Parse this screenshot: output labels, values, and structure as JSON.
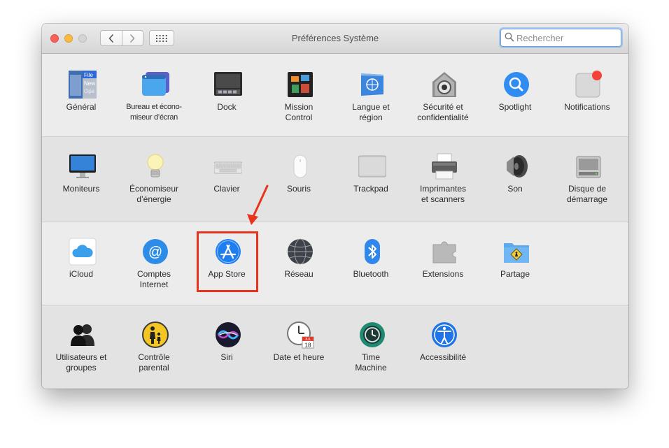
{
  "window": {
    "title": "Préférences Système",
    "search_placeholder": "Rechercher"
  },
  "colors": {
    "highlight": "#e8341c",
    "accent_blue": "#1e7ef0"
  },
  "rows": [
    [
      {
        "label": "Général",
        "icon": "general-icon"
      },
      {
        "label": "Bureau et écono-\nmiseur d’écran",
        "icon": "desktop-screensaver-icon"
      },
      {
        "label": "Dock",
        "icon": "dock-icon"
      },
      {
        "label": "Mission\nControl",
        "icon": "mission-control-icon"
      },
      {
        "label": "Langue et\nrégion",
        "icon": "language-region-icon"
      },
      {
        "label": "Sécurité et\nconfidentialité",
        "icon": "security-privacy-icon"
      },
      {
        "label": "Spotlight",
        "icon": "spotlight-icon"
      },
      {
        "label": "Notifications",
        "icon": "notifications-icon"
      }
    ],
    [
      {
        "label": "Moniteurs",
        "icon": "displays-icon"
      },
      {
        "label": "Économiseur\nd’énergie",
        "icon": "energy-saver-icon"
      },
      {
        "label": "Clavier",
        "icon": "keyboard-icon"
      },
      {
        "label": "Souris",
        "icon": "mouse-icon"
      },
      {
        "label": "Trackpad",
        "icon": "trackpad-icon"
      },
      {
        "label": "Imprimantes\net scanners",
        "icon": "printers-scanners-icon"
      },
      {
        "label": "Son",
        "icon": "sound-icon"
      },
      {
        "label": "Disque de\ndémarrage",
        "icon": "startup-disk-icon"
      }
    ],
    [
      {
        "label": "iCloud",
        "icon": "icloud-icon"
      },
      {
        "label": "Comptes\nInternet",
        "icon": "internet-accounts-icon"
      },
      {
        "label": "App Store",
        "icon": "app-store-icon"
      },
      {
        "label": "Réseau",
        "icon": "network-icon"
      },
      {
        "label": "Bluetooth",
        "icon": "bluetooth-icon"
      },
      {
        "label": "Extensions",
        "icon": "extensions-icon"
      },
      {
        "label": "Partage",
        "icon": "sharing-icon"
      }
    ],
    [
      {
        "label": "Utilisateurs et\ngroupes",
        "icon": "users-groups-icon"
      },
      {
        "label": "Contrôle\nparental",
        "icon": "parental-controls-icon"
      },
      {
        "label": "Siri",
        "icon": "siri-icon"
      },
      {
        "label": "Date et heure",
        "icon": "date-time-icon"
      },
      {
        "label": "Time\nMachine",
        "icon": "time-machine-icon"
      },
      {
        "label": "Accessibilité",
        "icon": "accessibility-icon"
      }
    ]
  ],
  "icon_text": {
    "general_menu": [
      "File",
      "New",
      "Ope"
    ],
    "calendar_month": "JUL",
    "calendar_day": "18"
  }
}
